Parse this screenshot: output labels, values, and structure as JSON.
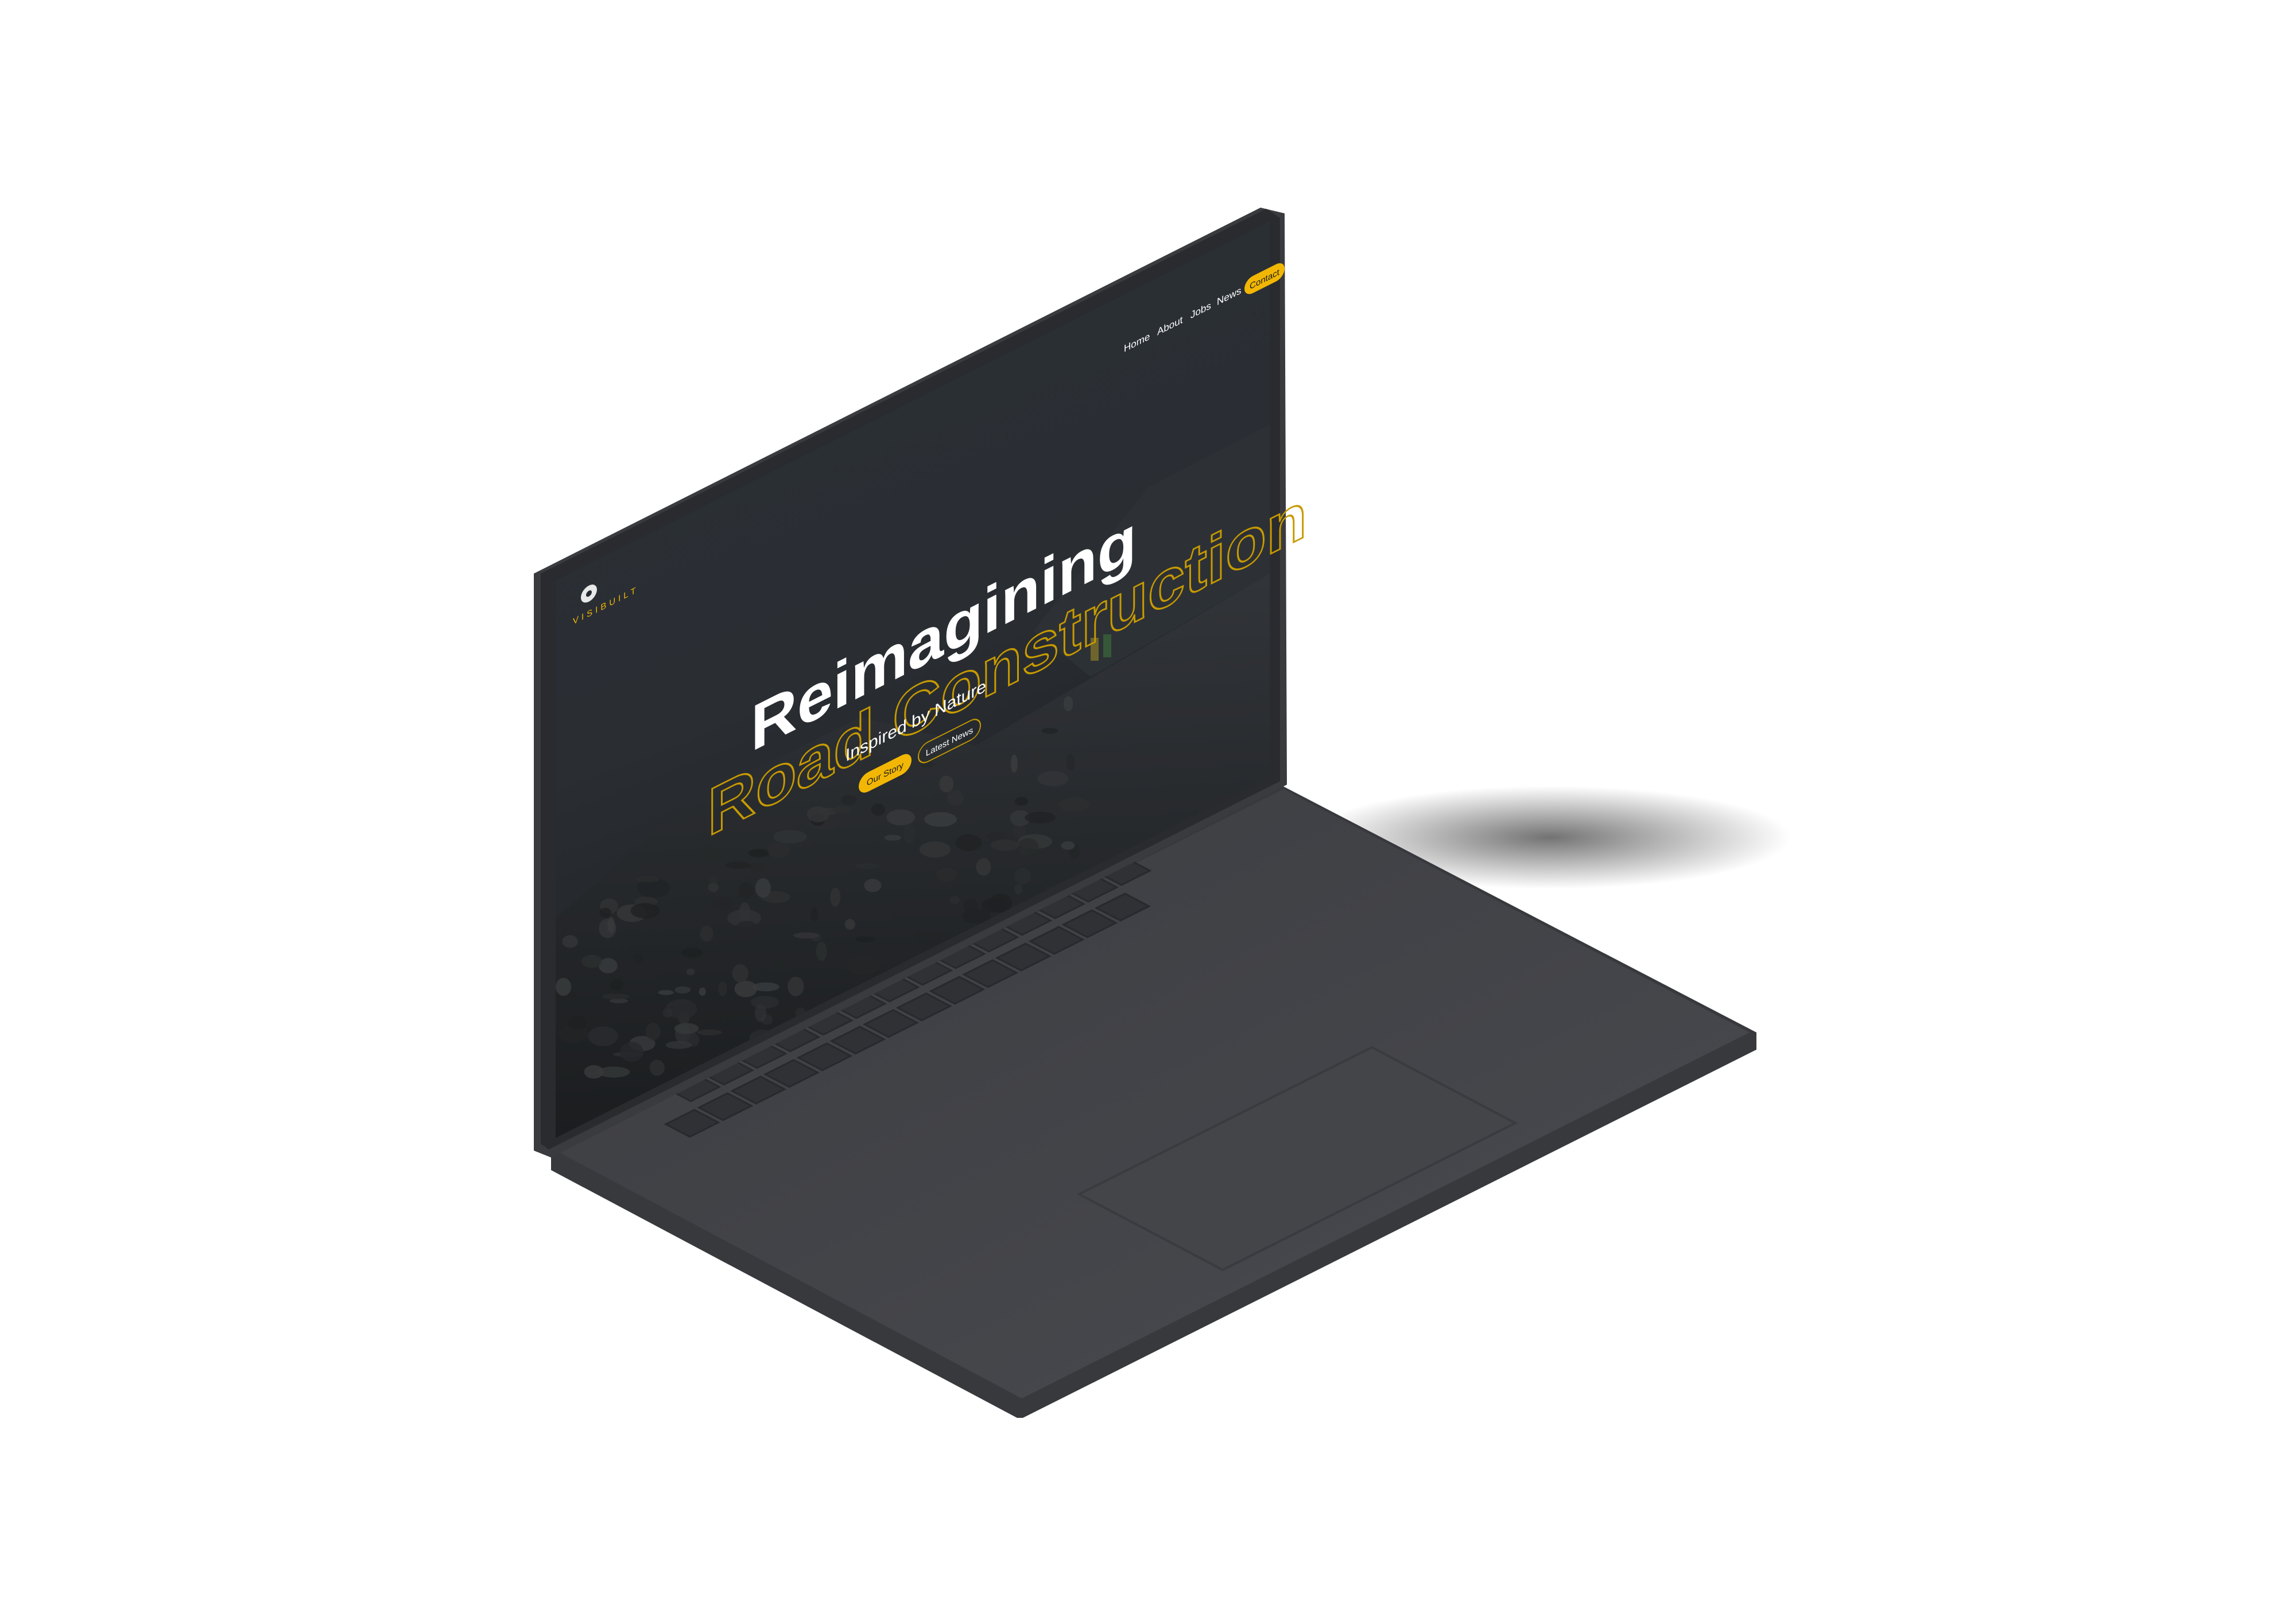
{
  "brand": {
    "logo_text": "VISIBUILT",
    "accent_color": "#f2b705"
  },
  "nav": {
    "items": [
      {
        "label": "Home"
      },
      {
        "label": "About"
      },
      {
        "label": "Jobs"
      },
      {
        "label": "News"
      }
    ],
    "contact_label": "Contact"
  },
  "hero": {
    "headline": "Reimagining",
    "outline_headline": "Road Construction",
    "tagline": "Inspired by Nature",
    "primary_button": "Our Story",
    "secondary_button": "Latest News"
  },
  "colors": {
    "screen_bg": "#262b30",
    "laptop_body": "#3d3e42",
    "laptop_deck": "#47484c",
    "key": "#2f3034",
    "button_text_dark": "#1a1a1a",
    "text_light": "#ffffff"
  }
}
